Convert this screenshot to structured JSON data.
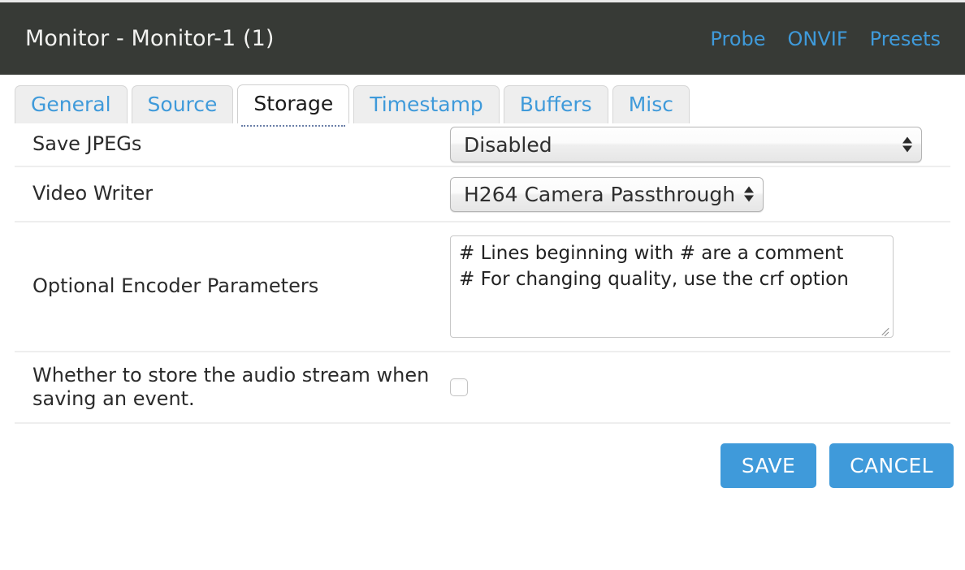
{
  "header": {
    "title": "Monitor - Monitor-1 (1)",
    "links": [
      {
        "label": "Probe",
        "name": "probe-link"
      },
      {
        "label": "ONVIF",
        "name": "onvif-link"
      },
      {
        "label": "Presets",
        "name": "presets-link"
      }
    ]
  },
  "tabs": [
    {
      "label": "General",
      "active": false
    },
    {
      "label": "Source",
      "active": false
    },
    {
      "label": "Storage",
      "active": true
    },
    {
      "label": "Timestamp",
      "active": false
    },
    {
      "label": "Buffers",
      "active": false
    },
    {
      "label": "Misc",
      "active": false
    }
  ],
  "form": {
    "save_jpegs": {
      "label": "Save JPEGs",
      "value": "Disabled"
    },
    "video_writer": {
      "label": "Video Writer",
      "value": "H264 Camera Passthrough"
    },
    "encoder_params": {
      "label": "Optional Encoder Parameters",
      "value": "# Lines beginning with # are a comment\n# For changing quality, use the crf option"
    },
    "store_audio": {
      "label": "Whether to store the audio stream when saving an event.",
      "checked": false
    }
  },
  "footer": {
    "save_label": "SAVE",
    "cancel_label": "CANCEL"
  },
  "colors": {
    "accent_blue": "#3f9ada",
    "titlebar_bg": "#373a36",
    "row_divider": "#eeeeee",
    "tab_inactive_bg": "#eeeeee"
  }
}
